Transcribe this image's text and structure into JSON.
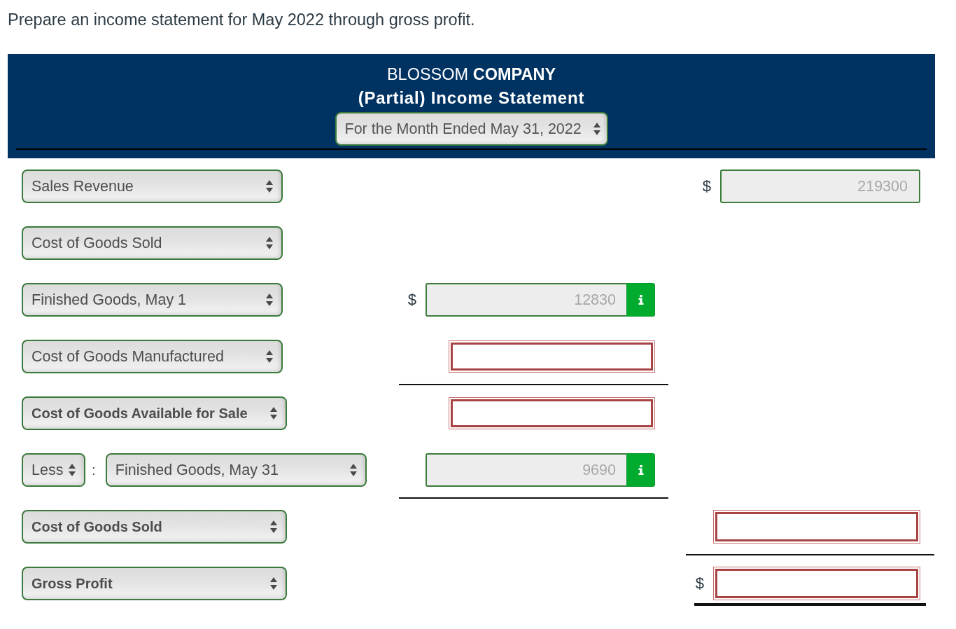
{
  "prompt": "Prepare an income statement for May 2022 through gross profit.",
  "header": {
    "company": "BLOSSOM **COMPANY**",
    "title": "(Partial) Income Statement",
    "period": "For the Month Ended May 31, 2022"
  },
  "rows": [
    {
      "label": {
        "value": "Sales Revenue",
        "bold": false
      },
      "right": {
        "kind": "prefilled",
        "currency": "$",
        "value": "219300",
        "disabled": true,
        "info": false,
        "underline": false,
        "double_underline": false
      }
    },
    {
      "label": {
        "value": "Cost of Goods Sold",
        "bold": false
      }
    },
    {
      "label": {
        "value": "Finished Goods, May 1",
        "bold": false
      },
      "middle": {
        "kind": "prefilled",
        "currency": "$",
        "value": "12830",
        "disabled": true,
        "info": true,
        "underline": false,
        "double_underline": false
      }
    },
    {
      "label": {
        "value": "Cost of Goods Manufactured",
        "bold": false
      },
      "middle": {
        "kind": "blank",
        "disabled": false,
        "underline": true,
        "double_underline": false
      }
    },
    {
      "label": {
        "value": "Cost of Goods Available for Sale",
        "bold": true
      },
      "middle": {
        "kind": "blank",
        "disabled": false,
        "underline": false,
        "double_underline": false
      }
    },
    {
      "prefix": {
        "value": "Less",
        "separator": ":"
      },
      "label": {
        "value": "Finished Goods, May 31",
        "bold": false
      },
      "middle": {
        "kind": "prefilled",
        "value": "9690",
        "disabled": true,
        "info": true,
        "underline": true,
        "double_underline": false
      }
    },
    {
      "label": {
        "value": "Cost of Goods Sold",
        "bold": true
      },
      "right": {
        "kind": "blank",
        "disabled": false,
        "underline": true,
        "double_underline": false
      }
    },
    {
      "label": {
        "value": "Gross Profit",
        "bold": true
      },
      "right": {
        "kind": "blank",
        "currency": "$",
        "disabled": false,
        "underline": false,
        "double_underline": true
      }
    }
  ]
}
